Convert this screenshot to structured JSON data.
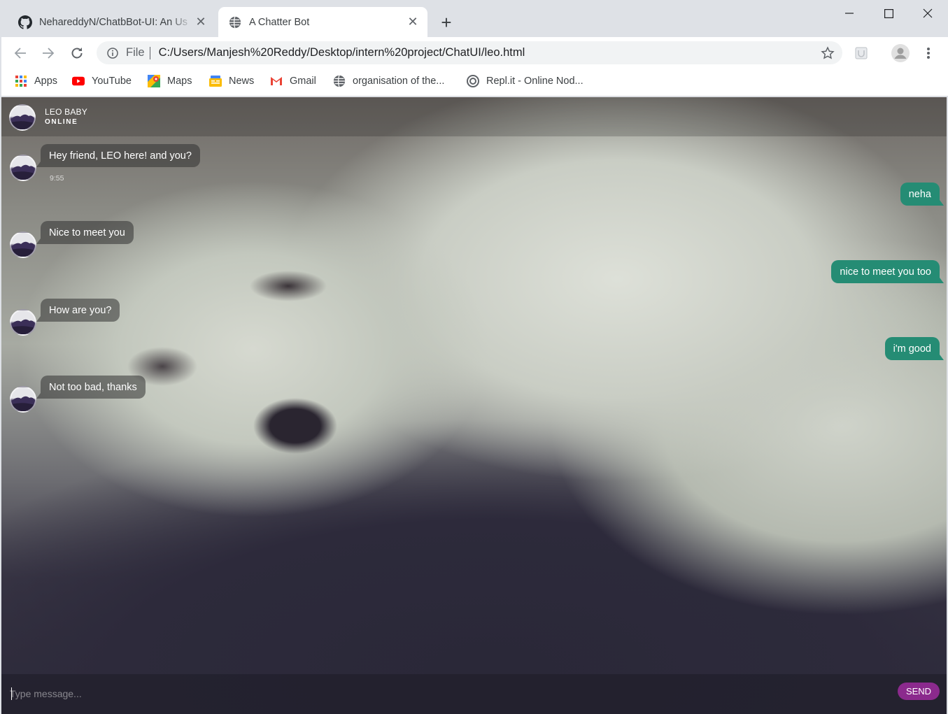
{
  "browser": {
    "tabs": [
      {
        "title": "NehareddyN/ChatbBot-UI: An Us",
        "icon": "github-icon",
        "active": false
      },
      {
        "title": "A Chatter Bot",
        "icon": "globe-icon",
        "active": true
      }
    ],
    "address": {
      "scheme": "File",
      "url": "C:/Users/Manjesh%20Reddy/Desktop/intern%20project/ChatUI/leo.html"
    },
    "bookmarks": [
      {
        "label": "Apps",
        "icon": "apps-grid-icon"
      },
      {
        "label": "YouTube",
        "icon": "youtube-icon"
      },
      {
        "label": "Maps",
        "icon": "maps-icon"
      },
      {
        "label": "News",
        "icon": "news-icon"
      },
      {
        "label": "Gmail",
        "icon": "gmail-icon"
      },
      {
        "label": "organisation of the...",
        "icon": "globe-icon"
      },
      {
        "label": "Repl.it - Online Nod...",
        "icon": "replit-icon"
      }
    ]
  },
  "chat": {
    "bot_name": "LEO BABY",
    "status": "ONLINE",
    "messages": [
      {
        "from": "bot",
        "text": "Hey friend, LEO here! and you?",
        "time": "9:55"
      },
      {
        "from": "user",
        "text": "neha"
      },
      {
        "from": "bot",
        "text": "Nice to meet you"
      },
      {
        "from": "user",
        "text": "nice to meet you too"
      },
      {
        "from": "bot",
        "text": "How are you?"
      },
      {
        "from": "user",
        "text": "i'm good"
      },
      {
        "from": "bot",
        "text": "Not too bad, thanks"
      }
    ],
    "composer": {
      "placeholder": "Type message...",
      "value": "",
      "send_label": "SEND"
    }
  },
  "colors": {
    "user_bubble": "#258c74",
    "send_button": "#8b2a8d"
  }
}
